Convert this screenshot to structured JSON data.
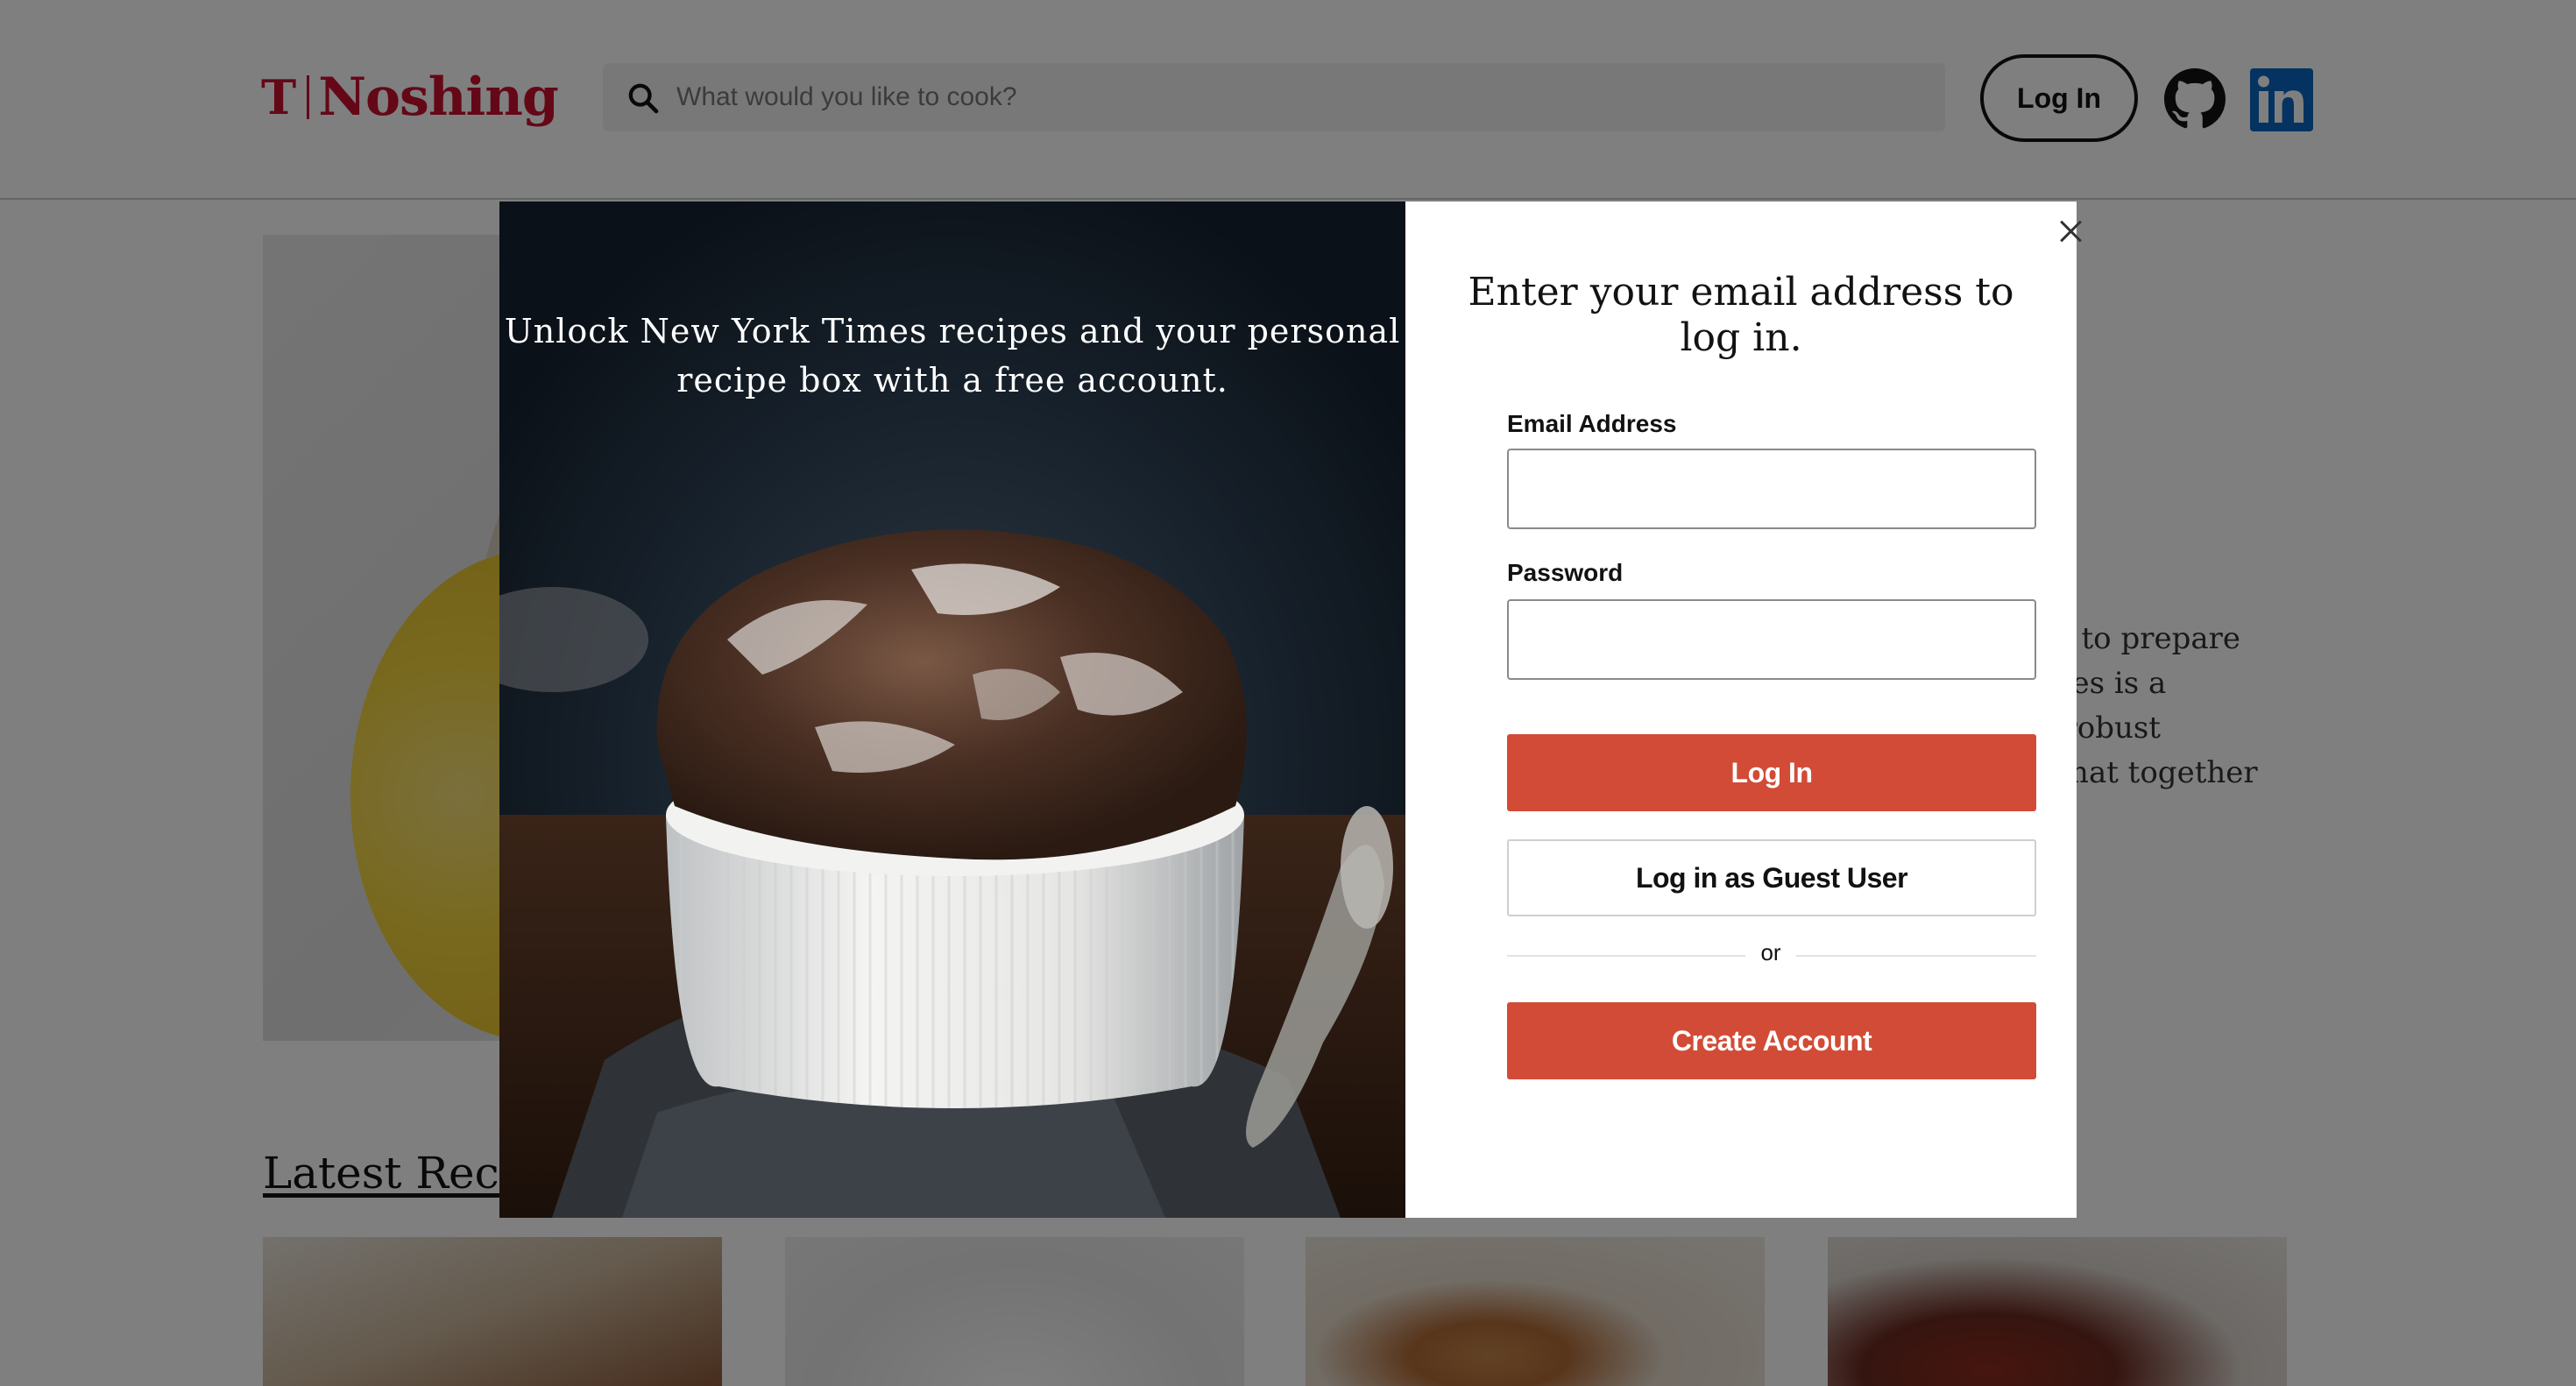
{
  "header": {
    "logo_mark": "T",
    "logo_text": "Noshing",
    "search_placeholder": "What would you like to cook?",
    "login_label": "Log In",
    "github_icon": "github-icon",
    "linkedin_icon": "linkedin-icon"
  },
  "page": {
    "feature_text_lines": [
      "sier to prepare",
      "mmes is a",
      "nd robust",
      "es that together"
    ],
    "latest_title": "Latest Recip"
  },
  "modal": {
    "promo_text": "Unlock New York Times recipes and your personal recipe box with a free account.",
    "heading": "Enter your email address to log in.",
    "email_label": "Email Address",
    "password_label": "Password",
    "login_button": "Log In",
    "guest_button": "Log in as Guest User",
    "or_text": "or",
    "create_button": "Create Account",
    "close_icon": "close-icon"
  },
  "colors": {
    "brand_red": "#c8102e",
    "button_red": "#d24b36",
    "linkedin_blue": "#0a66c2",
    "overlay": "rgba(0,0,0,0.5)"
  }
}
